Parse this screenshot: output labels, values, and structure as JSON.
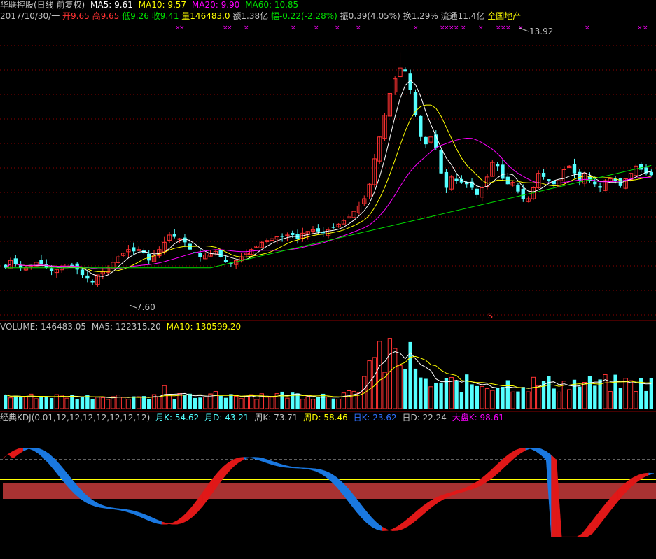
{
  "colors": {
    "up": "#ff3232",
    "down": "#54ffff",
    "ma5": "#ffffff",
    "ma10": "#ffff00",
    "ma20": "#ff00ff",
    "ma60": "#00e000",
    "grid": "#8b0000"
  },
  "price_header": {
    "name": "华联控股(日线 前复权)",
    "ma5": "MA5: 9.61",
    "ma10": "MA10: 9.57",
    "ma20": "MA20: 9.90",
    "ma60": "MA60: 10.85"
  },
  "info_header": {
    "date": "2017/10/30/一",
    "open": "开9.65",
    "high": "高9.65",
    "low": "低9.26",
    "close": "收9.41",
    "volume": "量146483.0",
    "amount": "额1.38亿",
    "change": "幅-0.22(-2.28%)",
    "amplitude": "振0.39(4.05%)",
    "turnover": "换1.29%",
    "float": "流通11.4亿",
    "sector": "全国地产"
  },
  "price_labels": {
    "high_mark": "13.92",
    "low_mark": "7.60",
    "signal_mark": "S"
  },
  "volume_header": {
    "volume": "VOLUME: 146483.05",
    "ma5": "MA5: 122315.20",
    "ma10": "MA10: 130599.20"
  },
  "kdj_header": {
    "name": "经典KDJ(0.01,12,12,12,12,12,12,12)",
    "month_k": "月K: 54.62",
    "month_d": "月D: 43.21",
    "week_k": "周K: 73.71",
    "week_d": "周D: 58.46",
    "day_k": "日K: 23.62",
    "day_d": "日D: 22.24",
    "index_k": "大盘K: 98.61"
  },
  "chart_data": [
    {
      "type": "candlestick",
      "title": "华联控股(日线 前复权)",
      "ylim": [
        6.8,
        14.6
      ],
      "series": [
        {
          "name": "MA5",
          "color": "#ffffff"
        },
        {
          "name": "MA10",
          "color": "#ffff00"
        },
        {
          "name": "MA20",
          "color": "#ff00ff"
        },
        {
          "name": "MA60",
          "color": "#00e000"
        }
      ],
      "closes": [
        8.0,
        8.2,
        8.1,
        8.0,
        8.0,
        8.05,
        8.15,
        8.1,
        8.0,
        7.9,
        7.95,
        8.05,
        8.1,
        8.05,
        7.95,
        7.8,
        7.7,
        7.6,
        7.8,
        7.9,
        8.0,
        8.15,
        8.3,
        8.4,
        8.5,
        8.45,
        8.5,
        8.4,
        8.2,
        8.35,
        8.5,
        8.7,
        8.9,
        8.85,
        8.8,
        8.7,
        8.5,
        8.4,
        8.3,
        8.35,
        8.4,
        8.45,
        8.3,
        8.15,
        8.1,
        8.2,
        8.3,
        8.4,
        8.5,
        8.6,
        8.7,
        8.75,
        8.8,
        8.85,
        8.85,
        8.9,
        8.9,
        8.8,
        8.95,
        9.0,
        9.05,
        9.0,
        8.95,
        9.05,
        9.1,
        9.2,
        9.3,
        9.4,
        9.55,
        9.7,
        9.9,
        10.3,
        11.0,
        11.6,
        12.2,
        12.8,
        13.2,
        13.5,
        13.4,
        12.9,
        12.2,
        11.6,
        11.4,
        11.6,
        11.3,
        10.6,
        10.2,
        10.5,
        10.4,
        10.35,
        10.3,
        10.2,
        10.0,
        10.2,
        10.5,
        10.9,
        10.8,
        10.45,
        10.3,
        10.35,
        10.1,
        9.9,
        9.9,
        10.2,
        10.6,
        10.5,
        10.4,
        10.3,
        10.4,
        10.7,
        10.8,
        10.6,
        10.4,
        10.6,
        10.4,
        10.3,
        10.2,
        10.4,
        10.45,
        10.4,
        10.25,
        10.45,
        10.6,
        10.8,
        10.7,
        10.6,
        10.55
      ],
      "ma60_note": "rising from ~8.0 to ~10.85"
    },
    {
      "type": "bar",
      "title": "VOLUME",
      "series": [
        {
          "name": "MA5",
          "color": "#ffffff"
        },
        {
          "name": "MA10",
          "color": "#ffff00"
        }
      ]
    },
    {
      "type": "area",
      "title": "经典KDJ(0.01,12,12,12,12,12,12,12)",
      "ylim": [
        0,
        100
      ]
    }
  ]
}
